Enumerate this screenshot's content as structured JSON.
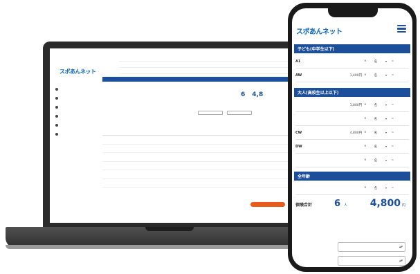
{
  "colors": {
    "primary": "#1b4e9b",
    "accent": "#e85b1a",
    "logo_blue": "#0a67c2",
    "logo_orange": "#f29d0e"
  },
  "laptop": {
    "logo": "スポあんネット",
    "menu": [
      "",
      "",
      "",
      "",
      "",
      ""
    ],
    "total": {
      "count": "6",
      "amount": "4,8"
    },
    "more_button": ""
  },
  "phone": {
    "logo": "スポあんネット",
    "menu_icon": "hamburger-icon",
    "sections": [
      {
        "title": "子ども(中学生以下)",
        "note": "",
        "rows": [
          {
            "name": "A1",
            "sub": "",
            "price": "",
            "qty": "名",
            "result": ""
          },
          {
            "name": "AW",
            "sub": "",
            "price": "1,400円",
            "qty": "名",
            "result": ""
          }
        ]
      },
      {
        "title": "大人(高校生以上以下)",
        "note": "",
        "rows": [
          {
            "name": "",
            "sub": "",
            "price": "1,800円",
            "qty": "名",
            "result": ""
          },
          {
            "name": "",
            "sub": "",
            "price": "",
            "qty": "名",
            "result": ""
          },
          {
            "name": "CW",
            "sub": "",
            "price": "4,800円",
            "qty": "名",
            "result": ""
          },
          {
            "name": "DW",
            "sub": "",
            "price": "",
            "qty": "名",
            "result": ""
          },
          {
            "name": "",
            "sub": "",
            "price": "",
            "qty": "名",
            "result": ""
          }
        ]
      },
      {
        "title": "全年齢",
        "note": "",
        "rows": [
          {
            "name": "",
            "sub": "",
            "price": "",
            "qty": "名",
            "result": ""
          }
        ]
      }
    ],
    "total": {
      "label": "保険合計",
      "count": "6",
      "count_unit": "人",
      "amount": "4,800",
      "amount_unit": "円"
    },
    "description": "",
    "selects": [
      {
        "value": ""
      },
      {
        "value": ""
      }
    ]
  }
}
